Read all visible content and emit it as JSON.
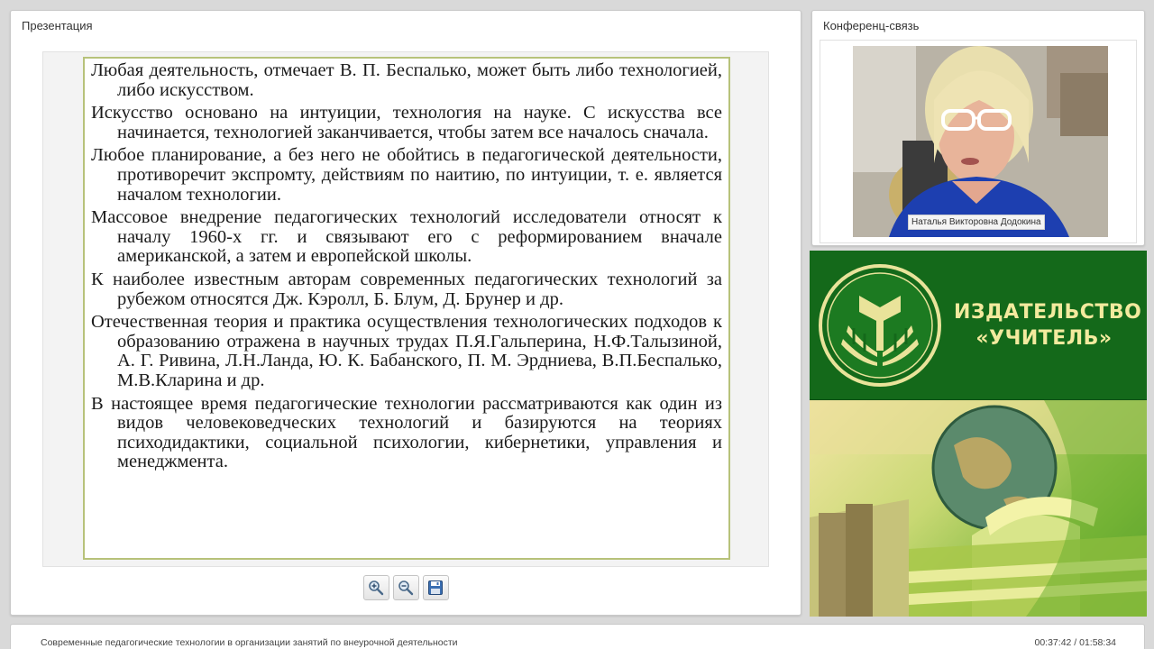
{
  "presentation": {
    "title": "Презентация",
    "paragraphs": [
      "Любая деятельность, отмечает В. П. Беспалько, может быть либо технологией, либо искусством.",
      "Искусство основано на интуиции, технология на науке. С искусства все начинается, технологией заканчивается, чтобы затем все началось сначала.",
      "Любое планирование, а без него не обойтись в педагогической деятельности, противоречит экспромту, действиям по наитию, по интуиции, т. е. является началом технологии.",
      "Массовое внедрение педагогических технологий исследователи относят к началу 1960-х гг. и связывают его с реформированием вначале американской, а затем и европейской школы.",
      "К наиболее известным авторам современных педагогических технологий за рубежом относятся Дж. Кэролл, Б. Блум, Д. Брунер и др.",
      "Отечественная теория и практика осуществления технологических подходов к образованию отражена в научных трудах П.Я.Гальперина, Н.Ф.Талызиной, А. Г. Ривина, Л.Н.Ланда, Ю. К. Бабанского, П. М. Эрдниева,  В.П.Беспалько, М.В.Кларина и др.",
      "В настоящее время педагогические технологии рассматриваются как один из видов человековедческих технологий и базируются на теориях психодидактики, социальной психологии, кибернетики, управления и менеджмента."
    ],
    "toolbar": {
      "zoom_in_icon": "zoom-in-icon",
      "zoom_out_icon": "zoom-out-icon",
      "save_icon": "floppy-save-icon"
    }
  },
  "conference": {
    "title": "Конференц-связь",
    "participant_name": "Наталья Викторовна Додокина"
  },
  "banner": {
    "publisher_line1": "ИЗДАТЕЛЬСТВО",
    "publisher_line2": "«УЧИТЕЛЬ»",
    "logo_icon": "publisher-book-logo-icon",
    "colors": {
      "green": "#14691a",
      "text": "#f3ea9e"
    }
  },
  "status": {
    "course_title": "Современные педагогические технологии в организации занятий по внеурочной деятельности",
    "time": "00:37:42 / 01:58:34"
  }
}
